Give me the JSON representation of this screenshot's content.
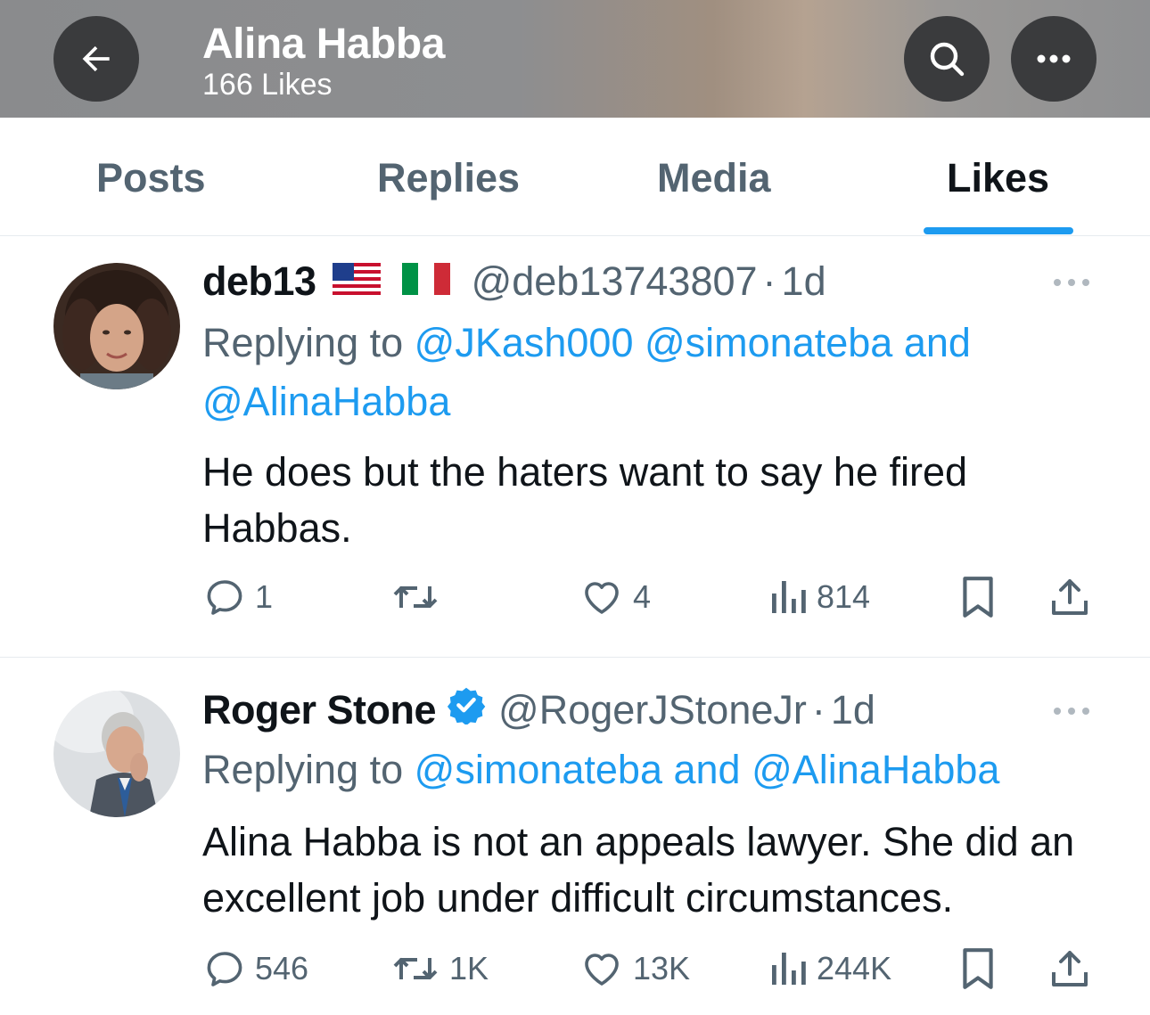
{
  "header": {
    "title": "Alina Habba",
    "subtitle": "166 Likes",
    "icons": [
      "back-arrow-icon",
      "search-icon",
      "more-icon"
    ]
  },
  "tabs": [
    {
      "label": "Posts",
      "active": false
    },
    {
      "label": "Replies",
      "active": false
    },
    {
      "label": "Media",
      "active": false
    },
    {
      "label": "Likes",
      "active": true
    }
  ],
  "colors": {
    "accent": "#1d9bf0",
    "text": "#0f1419",
    "secondary": "#536471",
    "verified": "#1d9bf0"
  },
  "tweets": [
    {
      "display_name": "deb13",
      "flags": [
        "us-flag-icon",
        "italy-flag-icon"
      ],
      "handle": "@deb13743807",
      "separator": "·",
      "time": "1d",
      "reply_prefix": "Replying to",
      "reply_mentions": "@JKash000 @simonateba and",
      "reply_mentions_2": "@AlinaHabba",
      "text": "He does but the haters want to say he fired Habbas.",
      "stats": {
        "replies": "1",
        "reposts": "",
        "likes": "4",
        "views": "814"
      }
    },
    {
      "display_name": "Roger Stone",
      "verified": true,
      "handle": "@RogerJStoneJr",
      "separator": "·",
      "time": "1d",
      "reply_prefix": "Replying to",
      "reply_mentions": "@simonateba and @AlinaHabba",
      "text": "Alina Habba is not an appeals lawyer. She did an excellent job under difficult circumstances.",
      "stats": {
        "replies": "546",
        "reposts": "1K",
        "likes": "13K",
        "views": "244K"
      }
    }
  ]
}
